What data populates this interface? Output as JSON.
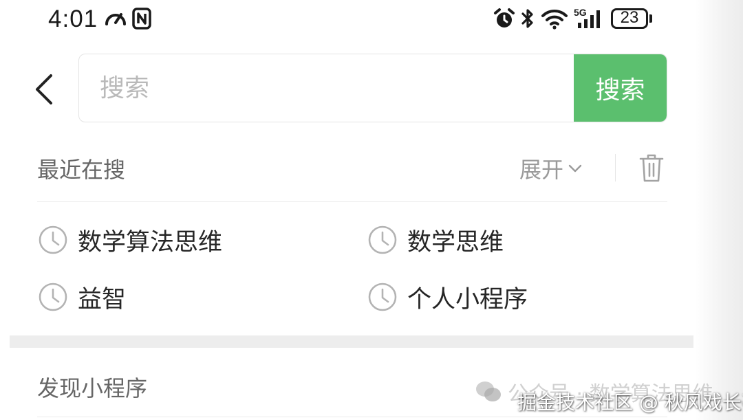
{
  "status_bar": {
    "time": "4:01",
    "network": "5G",
    "battery": "23",
    "icons": [
      "speed-gauge-icon",
      "nfc-icon",
      "alarm-icon",
      "bluetooth-icon",
      "wifi-icon",
      "signal-icon",
      "battery-icon"
    ]
  },
  "search": {
    "placeholder": "搜索",
    "value": "",
    "button_label": "搜索"
  },
  "recent": {
    "title": "最近在搜",
    "expand_label": "展开",
    "items": [
      {
        "label": "数学算法思维"
      },
      {
        "label": "数学思维"
      },
      {
        "label": "益智"
      },
      {
        "label": "个人小程序"
      }
    ]
  },
  "discover": {
    "title": "发现小程序"
  },
  "watermark": {
    "wechat_account": "公众号 · 数学算法思维",
    "juejin": "掘金技术社区 @ 秋风戏长亭"
  },
  "colors": {
    "accent_green": "#5bbf6e",
    "placeholder_gray": "#b9b9b9",
    "section_gray": "#666666"
  }
}
